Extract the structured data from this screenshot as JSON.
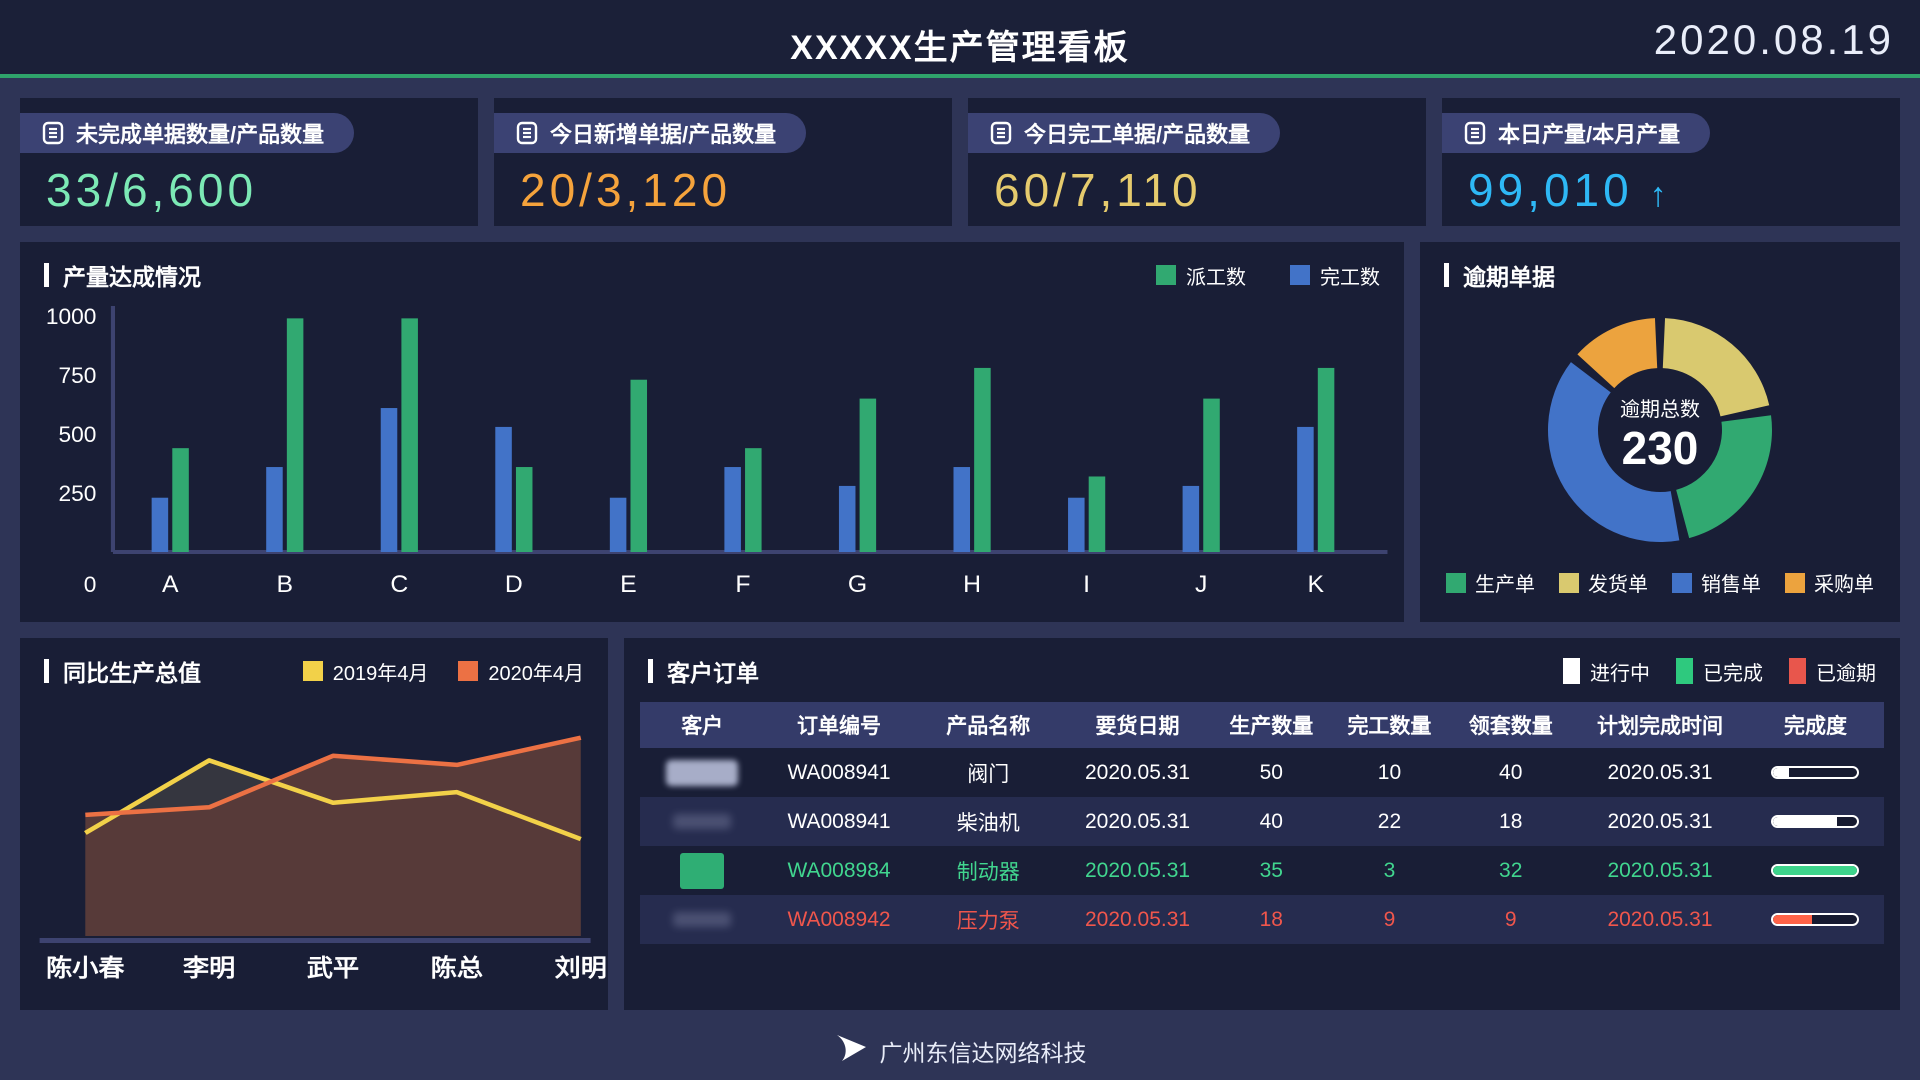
{
  "header": {
    "title": "XXXXX生产管理看板",
    "date": "2020.08.19"
  },
  "kpi_cards": [
    {
      "label": "未完成单据数量/产品数量",
      "value": "33/6,600",
      "arrow": "",
      "color": "#7ce9b5"
    },
    {
      "label": "今日新增单据/产品数量",
      "value": "20/3,120",
      "arrow": "",
      "color": "#f5a33c"
    },
    {
      "label": "今日完工单据/产品数量",
      "value": "60/7,110",
      "arrow": "",
      "color": "#e6cb6d"
    },
    {
      "label": "本日产量/本月产量",
      "value": "99,010",
      "arrow": "↑",
      "color": "#2eb8f5"
    }
  ],
  "footer": {
    "company": "广州东信达网络科技"
  },
  "chart_data": [
    {
      "type": "bar",
      "title": "产量达成情况",
      "categories": [
        "A",
        "B",
        "C",
        "D",
        "E",
        "F",
        "G",
        "H",
        "I",
        "J",
        "K"
      ],
      "series": [
        {
          "name": "完工数",
          "color": "#4273c8",
          "values": [
            230,
            360,
            610,
            530,
            230,
            360,
            280,
            360,
            230,
            280,
            530
          ]
        },
        {
          "name": "派工数",
          "color": "#31a971",
          "values": [
            440,
            990,
            990,
            360,
            730,
            440,
            650,
            780,
            320,
            650,
            780
          ]
        }
      ],
      "legend_order": [
        "派工数",
        "完工数"
      ],
      "legend_position": "top-right",
      "ylim": [
        0,
        1000
      ],
      "yticks": [
        0,
        250,
        500,
        750,
        1000
      ],
      "grid": false
    },
    {
      "type": "pie",
      "title": "逾期单据",
      "donut": true,
      "center_label": "逾期总数",
      "center_value": "230",
      "slices": [
        {
          "name": "发货单",
          "value": 51,
          "color": "#d9c96f"
        },
        {
          "name": "生产单",
          "value": 56,
          "color": "#31a971"
        },
        {
          "name": "销售单",
          "value": 91,
          "color": "#4273c8"
        },
        {
          "name": "采购单",
          "value": 32,
          "color": "#eca33e"
        }
      ],
      "legend_order": [
        "生产单",
        "发货单",
        "销售单",
        "采购单"
      ],
      "start_angle": "top",
      "clockwise": true
    },
    {
      "type": "line",
      "title": "同比生产总值",
      "area": true,
      "categories": [
        "陈小春",
        "李明",
        "武平",
        "陈总",
        "刘明"
      ],
      "series": [
        {
          "name": "2019年4月",
          "color": "#f2d149",
          "fill": "#35363f",
          "values": [
            340,
            580,
            440,
            475,
            320
          ]
        },
        {
          "name": "2020年4月",
          "color": "#ec7144",
          "fill": "#573a39",
          "values": [
            400,
            425,
            595,
            565,
            655
          ]
        }
      ],
      "ylim": [
        0,
        700
      ],
      "legend_position": "top-right"
    },
    {
      "type": "table",
      "title": "客户订单",
      "status_legend": [
        {
          "label": "进行中",
          "color": "#ffffff"
        },
        {
          "label": "已完成",
          "color": "#2ec97e"
        },
        {
          "label": "已逾期",
          "color": "#e8564c"
        }
      ],
      "columns": [
        "客户",
        "订单编号",
        "产品名称",
        "要货日期",
        "生产数量",
        "完工数量",
        "领套数量",
        "计划完成时间",
        "完成度"
      ],
      "rows": [
        {
          "logo": "blurred",
          "order_no": "WA008941",
          "product": "阀门",
          "due_date": "2020.05.31",
          "prod_qty": "50",
          "done_qty": "10",
          "set_qty": "40",
          "plan_date": "2020.05.31",
          "progress_pct": 18,
          "status": "进行中"
        },
        {
          "logo": "faint",
          "order_no": "WA008941",
          "product": "柴油机",
          "due_date": "2020.05.31",
          "prod_qty": "40",
          "done_qty": "22",
          "set_qty": "18",
          "plan_date": "2020.05.31",
          "progress_pct": 76,
          "status": "进行中"
        },
        {
          "logo": "green-square",
          "order_no": "WA008984",
          "product": "制动器",
          "due_date": "2020.05.31",
          "prod_qty": "35",
          "done_qty": "3",
          "set_qty": "32",
          "plan_date": "2020.05.31",
          "progress_pct": 100,
          "status": "已完成"
        },
        {
          "logo": "faint",
          "order_no": "WA008942",
          "product": "压力泵",
          "due_date": "2020.05.31",
          "prod_qty": "18",
          "done_qty": "9",
          "set_qty": "9",
          "plan_date": "2020.05.31",
          "progress_pct": 46,
          "status": "已逾期"
        }
      ],
      "status_fill_colors": {
        "进行中": "#ffffff",
        "已完成": "#3ed48c",
        "已逾期": "#ff6348"
      },
      "status_text_colors": {
        "进行中": "#ffffff",
        "已完成": "#41d68f",
        "已逾期": "#f0564c"
      }
    }
  ]
}
